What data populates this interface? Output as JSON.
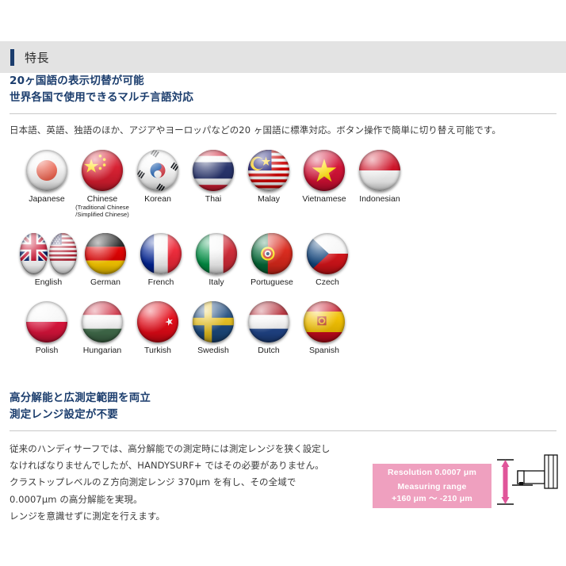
{
  "header": {
    "title": "特長",
    "accent_color": "#1b3d6d",
    "band_color": "#e3e3e3"
  },
  "section1": {
    "subhead_line1": "20ヶ国語の表示切替が可能",
    "subhead_line2": "世界各国で使用できるマルチ言語対応",
    "body": "日本語、英語、独語のほか、アジアやヨーロッパなどの20 ヶ国語に標準対応。ボタン操作で簡単に切り替え可能です。",
    "flag_rows": [
      [
        {
          "label": "Japanese",
          "sub": "",
          "flags": [
            "japan"
          ]
        },
        {
          "label": "Chinese",
          "sub": "(Traditional Chinese\n/Simplified Chinese)",
          "flags": [
            "china"
          ]
        },
        {
          "label": "Korean",
          "sub": "",
          "flags": [
            "korea"
          ]
        },
        {
          "label": "Thai",
          "sub": "",
          "flags": [
            "thailand"
          ]
        },
        {
          "label": "Malay",
          "sub": "",
          "flags": [
            "malaysia"
          ]
        },
        {
          "label": "Vietnamese",
          "sub": "",
          "flags": [
            "vietnam"
          ]
        },
        {
          "label": "Indonesian",
          "sub": "",
          "flags": [
            "indonesia"
          ]
        }
      ],
      [
        {
          "label": "English",
          "sub": "",
          "flags": [
            "uk",
            "usa"
          ]
        },
        {
          "label": "German",
          "sub": "",
          "flags": [
            "germany"
          ]
        },
        {
          "label": "French",
          "sub": "",
          "flags": [
            "france"
          ]
        },
        {
          "label": "Italy",
          "sub": "",
          "flags": [
            "italy"
          ]
        },
        {
          "label": "Portuguese",
          "sub": "",
          "flags": [
            "portugal"
          ]
        },
        {
          "label": "Czech",
          "sub": "",
          "flags": [
            "czech"
          ]
        }
      ],
      [
        {
          "label": "Polish",
          "sub": "",
          "flags": [
            "poland"
          ]
        },
        {
          "label": "Hungarian",
          "sub": "",
          "flags": [
            "hungary"
          ]
        },
        {
          "label": "Turkish",
          "sub": "",
          "flags": [
            "turkey"
          ]
        },
        {
          "label": "Swedish",
          "sub": "",
          "flags": [
            "sweden"
          ]
        },
        {
          "label": "Dutch",
          "sub": "",
          "flags": [
            "netherlands"
          ]
        },
        {
          "label": "Spanish",
          "sub": "",
          "flags": [
            "spain"
          ]
        }
      ]
    ]
  },
  "section2": {
    "subhead_line1": "高分解能と広測定範囲を両立",
    "subhead_line2": "測定レンジ設定が不要",
    "body_line1": "従来のハンディサーフでは、高分解能での測定時には測定レンジを狭く設定し",
    "body_line2": "なければなりませんでしたが、HANDYSURF+ ではその必要がありません。",
    "body_line3": "クラストップレベルのＺ方向測定レンジ 370μm を有し、その全域で",
    "body_line4": "0.0007μm の高分解能を実現。",
    "body_line5": "レンジを意識せずに測定を行えます。",
    "callout": {
      "line1": "Resolution 0.0007 μm",
      "line2": "Measuring range",
      "line3": "+160 μm ～ -210 μm",
      "bg_color": "#efa0bf",
      "arrow_color": "#e0559a"
    }
  }
}
